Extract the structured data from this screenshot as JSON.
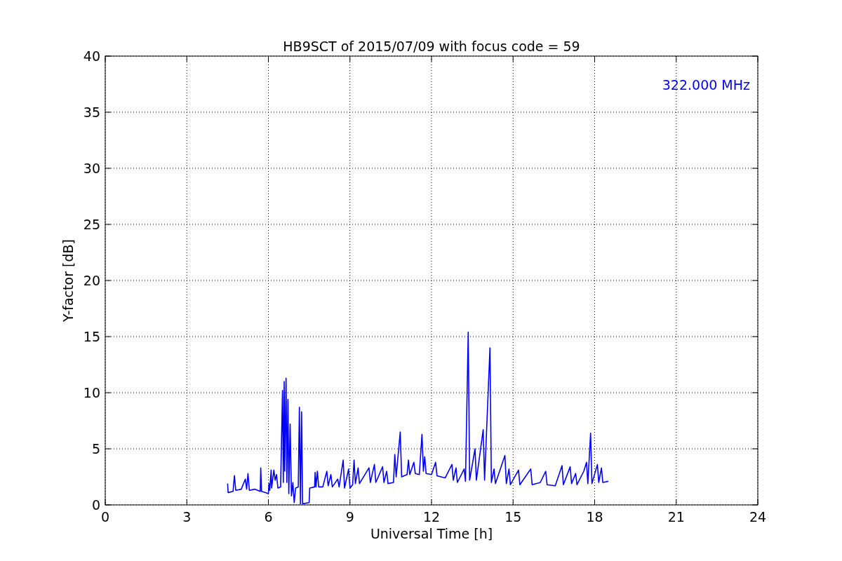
{
  "chart_data": {
    "type": "line",
    "title": "HB9SCT of 2015/07/09 with focus code = 59",
    "xlabel": "Universal Time [h]",
    "ylabel": "Y-factor [dB]",
    "xlim": [
      0,
      24
    ],
    "ylim": [
      0,
      40
    ],
    "xticks": [
      0,
      3,
      6,
      9,
      12,
      15,
      18,
      21,
      24
    ],
    "yticks": [
      0,
      5,
      10,
      15,
      20,
      25,
      30,
      35,
      40
    ],
    "grid": true,
    "x": [
      4.5,
      4.52,
      4.7,
      4.75,
      4.8,
      5.0,
      5.15,
      5.2,
      5.25,
      5.3,
      5.5,
      5.7,
      5.72,
      5.75,
      5.9,
      6.0,
      6.02,
      6.05,
      6.1,
      6.12,
      6.2,
      6.25,
      6.3,
      6.35,
      6.45,
      6.52,
      6.55,
      6.58,
      6.6,
      6.65,
      6.68,
      6.72,
      6.75,
      6.8,
      6.85,
      6.9,
      6.95,
      7.0,
      7.1,
      7.14,
      7.18,
      7.22,
      7.26,
      7.5,
      7.52,
      7.7,
      7.72,
      7.75,
      7.8,
      7.85,
      8.0,
      8.15,
      8.2,
      8.3,
      8.35,
      8.55,
      8.6,
      8.75,
      8.8,
      8.95,
      9.0,
      9.1,
      9.15,
      9.2,
      9.3,
      9.35,
      9.7,
      9.75,
      9.9,
      9.95,
      10.2,
      10.25,
      10.35,
      10.4,
      10.6,
      10.65,
      10.7,
      10.85,
      10.9,
      11.1,
      11.15,
      11.2,
      11.35,
      11.4,
      11.55,
      11.65,
      11.7,
      11.75,
      11.8,
      12.0,
      12.15,
      12.2,
      12.5,
      12.75,
      12.8,
      12.9,
      12.95,
      13.2,
      13.25,
      13.35,
      13.4,
      13.6,
      13.65,
      13.9,
      13.95,
      14.15,
      14.2,
      14.3,
      14.35,
      14.7,
      14.75,
      14.85,
      14.9,
      15.2,
      15.25,
      15.65,
      15.7,
      16.0,
      16.2,
      16.25,
      16.55,
      16.8,
      16.85,
      17.1,
      17.15,
      17.3,
      17.35,
      17.6,
      17.7,
      17.75,
      17.85,
      17.9,
      18.1,
      18.15,
      18.25,
      18.3,
      18.5
    ],
    "series": [
      {
        "name": "322.000 MHz",
        "color": "#0000ff",
        "values": [
          1.9,
          1.1,
          1.2,
          2.6,
          1.3,
          1.4,
          2.3,
          1.4,
          2.8,
          1.3,
          1.4,
          1.2,
          3.3,
          1.2,
          1.1,
          1.0,
          1.9,
          1.3,
          3.1,
          1.5,
          3.1,
          2.2,
          2.7,
          1.5,
          1.6,
          10.2,
          2.0,
          11.0,
          3.0,
          11.3,
          2.0,
          9.4,
          1.0,
          7.2,
          0.8,
          2.0,
          0.2,
          1.5,
          1.6,
          8.7,
          0.1,
          8.3,
          0.1,
          0.2,
          1.5,
          1.6,
          2.9,
          1.6,
          3.0,
          1.6,
          1.6,
          3.0,
          1.7,
          2.7,
          1.6,
          2.3,
          1.6,
          4.0,
          1.5,
          3.2,
          1.5,
          1.8,
          4.0,
          1.9,
          3.3,
          1.9,
          3.3,
          2.0,
          3.6,
          2.0,
          3.4,
          2.0,
          3.0,
          1.9,
          2.0,
          4.5,
          2.5,
          6.5,
          2.5,
          2.7,
          4.0,
          2.7,
          3.8,
          2.8,
          2.7,
          6.3,
          3.0,
          4.3,
          2.8,
          2.7,
          3.8,
          2.6,
          2.4,
          3.6,
          2.2,
          3.3,
          2.0,
          3.2,
          2.1,
          15.4,
          2.2,
          5.0,
          2.2,
          6.7,
          2.2,
          14.0,
          2.0,
          3.2,
          1.9,
          4.4,
          1.9,
          3.2,
          1.8,
          3.1,
          1.8,
          3.2,
          1.8,
          2.0,
          3.0,
          1.8,
          1.7,
          3.5,
          1.8,
          3.4,
          1.9,
          2.8,
          1.8,
          3.0,
          3.8,
          1.9,
          6.4,
          1.9,
          3.6,
          2.0,
          3.3,
          2.0,
          2.1
        ]
      }
    ]
  }
}
